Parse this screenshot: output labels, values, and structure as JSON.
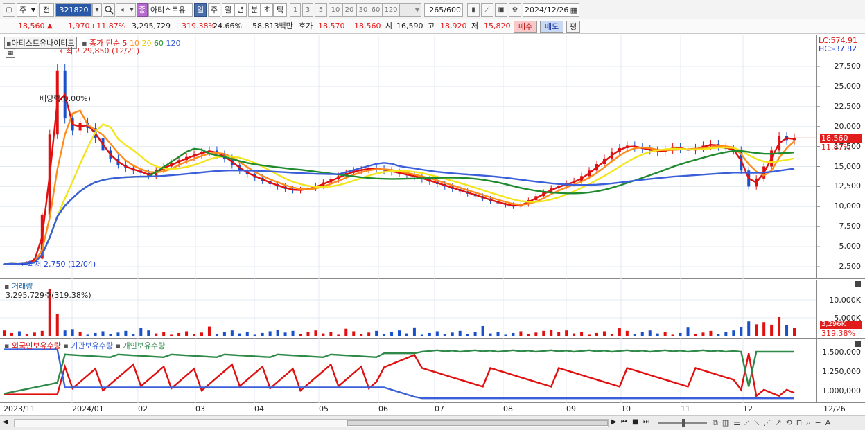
{
  "toolbar": {
    "period_select": "주",
    "market_select": "전",
    "code": "321820",
    "stock_badge": "종",
    "stock_name": "아티스트유",
    "period_tabs": [
      "일",
      "주",
      "월",
      "년",
      "분",
      "초",
      "틱"
    ],
    "intervals": [
      "1",
      "3",
      "5",
      "10",
      "20",
      "30",
      "60",
      "120"
    ],
    "count": "265",
    "count_total": "/600",
    "date": "2024/12/26"
  },
  "info": {
    "price": "18,560",
    "arrow": "▲",
    "change": "1,970",
    "change_pct": "+11.87%",
    "volume": "3,295,729",
    "volume_ratio": "319.38%",
    "turnover": "24.66%",
    "amount": "58,813백만",
    "quote_label": "호가",
    "ask": "18,570",
    "bid": "18,560",
    "open_label": "시",
    "open": "16,590",
    "high_label": "고",
    "high": "18,920",
    "low_label": "저",
    "low": "15,820",
    "buy_button": "매수",
    "sell_button": "매도",
    "eval_button": "평"
  },
  "price_pane": {
    "title": "아티스트유나이티드",
    "ma_label": "종가 단순",
    "ma_periods": [
      "5",
      "10",
      "20",
      "60",
      "120"
    ],
    "lc": "LC:574.91",
    "hc": "HC:-37.82",
    "high_note": "최고 29,850 (12/21)",
    "low_note": "최저 2,750 (12/04)",
    "dividend_note": "배당락(0.00%)",
    "current_price_tag": "18,560",
    "current_pct_tag": "11.87%",
    "y_ticks": [
      "27,500",
      "25,000",
      "22,500",
      "20,000",
      "17,500",
      "15,000",
      "12,500",
      "10,000",
      "7,500",
      "5,000",
      "2,500"
    ],
    "colors": {
      "ma5": "#e01010",
      "ma10": "#ff8c1a",
      "ma20": "#f2e51c",
      "ma60": "#1f8a2e",
      "ma120": "#3a5fd9",
      "up_candle": "#e01010",
      "down_candle": "#1a50c8"
    }
  },
  "volume_pane": {
    "title": "거래량",
    "value": "3,295,729주(319.38%)",
    "y_ticks": [
      "10,000K",
      "5,000K"
    ],
    "current_tag": "3,296K",
    "current_pct": "319.38%"
  },
  "holdings_pane": {
    "series_labels": [
      "외국인보유수량",
      "기관보유수량",
      "개인보유수량"
    ],
    "y_ticks": [
      "1,500,000",
      "1,250,000",
      "1,000,000"
    ],
    "colors": {
      "foreign": "#e01010",
      "institution": "#3a5fd9",
      "individual": "#2f8a4a"
    }
  },
  "x_axis": {
    "labels": [
      "2023/11",
      "2024/01",
      "02",
      "03",
      "04",
      "05",
      "06",
      "07",
      "08",
      "09",
      "10",
      "11",
      "12",
      "12/26"
    ]
  }
}
